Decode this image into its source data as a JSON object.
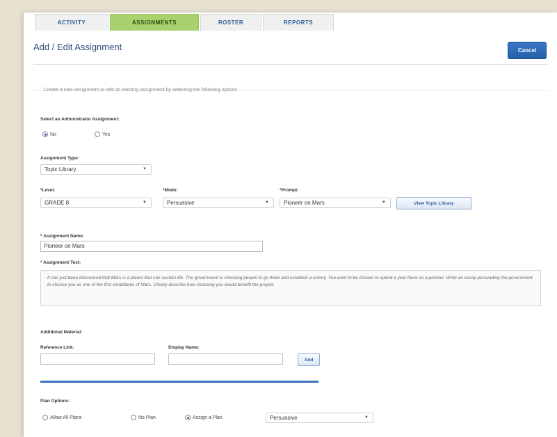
{
  "tabs": [
    "ACTIVITY",
    "ASSIGNMENTS",
    "ROSTER",
    "REPORTS"
  ],
  "title": "Add / Edit Assignment",
  "cancel_label": "Cancel",
  "intro": "Create a new assignment or edit an existing assignment by selecting the following options",
  "admin_assignment": {
    "label": "Select an Administrator Assignment:",
    "options": [
      "No",
      "Yes"
    ],
    "selected": "No"
  },
  "assignment_type": {
    "label": "Assignment Type:",
    "value": "Topic Library"
  },
  "level": {
    "label": "*Level:",
    "value": "GRADE 8"
  },
  "mode": {
    "label": "*Mode:",
    "value": "Persuasive"
  },
  "prompt": {
    "label": "*Prompt:",
    "value": "Pioneer on Mars"
  },
  "view_topic_library_label": "View Topic Library",
  "assignment_name": {
    "label": "* Assignment Name:",
    "value": "Pioneer on Mars"
  },
  "assignment_text": {
    "label": "* Assignment Text:",
    "value": "It has just been discovered that Mars is a planet that can sustain life. The government is choosing people to go there and establish a colony. You want to be chosen to spend a year there as a pioneer. Write an essay persuading the government to choose you as one of the first inhabitants of Mars. Clearly describe how choosing you would benefit the project."
  },
  "additional_material": {
    "label": "Additional Material:",
    "reference_link_label": "Reference Link:",
    "reference_link_value": "",
    "display_name_label": "Display Name:",
    "display_name_value": "",
    "add_label": "Add"
  },
  "plan_options": {
    "label": "Plan Options:",
    "options": [
      "Allow All Plans",
      "No Plan",
      "Assign a Plan"
    ],
    "selected": "Assign a Plan",
    "plan_select_value": "Persuasive"
  },
  "colors": {
    "active_tab": "#a9d16e",
    "accent_blue": "#235ea9",
    "background": "#e7e1d2"
  },
  "icons": {
    "select_caret": "chevron-down-icon"
  }
}
